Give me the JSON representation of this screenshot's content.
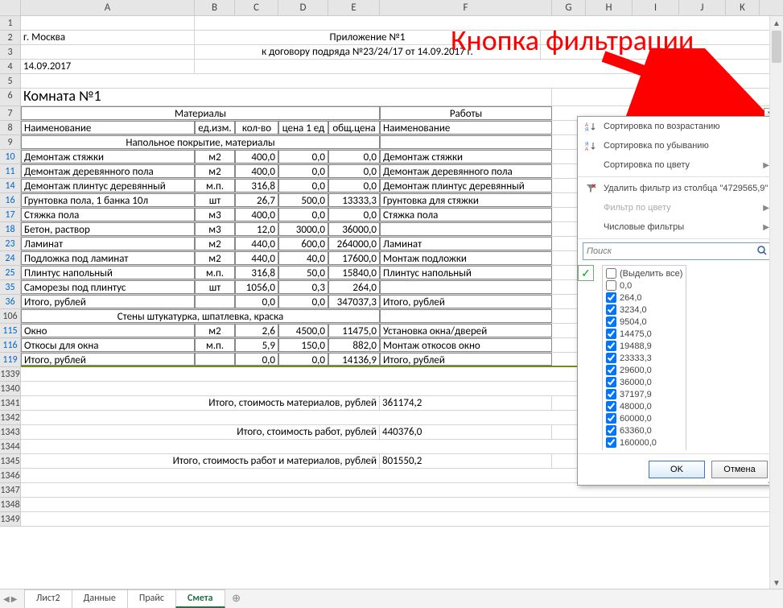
{
  "annotation": "Кнопка фильтрации",
  "columns": [
    "A",
    "B",
    "C",
    "D",
    "E",
    "F",
    "G",
    "H",
    "I",
    "J",
    "K"
  ],
  "row_numbers": [
    "1",
    "2",
    "3",
    "4",
    "5",
    "6",
    "7",
    "8",
    "9",
    "10",
    "11",
    "14",
    "16",
    "17",
    "18",
    "23",
    "24",
    "25",
    "35",
    "36",
    "106",
    "115",
    "116",
    "119",
    "1339",
    "1340",
    "1341",
    "1342",
    "1343",
    "1344",
    "1345",
    "1346",
    "1347",
    "1348",
    "1349"
  ],
  "header": {
    "city": "г. Москва",
    "date": "14.09.2017",
    "title1": "Приложение №1",
    "title2": "к договору подряда №23/24/17 от 14.09.2017 г."
  },
  "room_title": "Комната №1",
  "section_materials": "Материалы",
  "section_works": "Работы",
  "cols": {
    "name": "Наименование",
    "unit": "ед.изм.",
    "qty": "кол-во",
    "price": "цена 1 ед",
    "total": "общ.цена",
    "name2": "Наименование"
  },
  "subsection1": "Напольное покрытие, материалы",
  "subsection2": "Стены штукатурка, шпатлевка, краска",
  "rows": [
    {
      "a": "Демонтаж стяжки",
      "b": "м2",
      "c": "400,0",
      "d": "0,0",
      "e": "0,0",
      "f": "Демонтаж стяжки"
    },
    {
      "a": "Демонтаж деревянного пола",
      "b": "м2",
      "c": "400,0",
      "d": "0,0",
      "e": "0,0",
      "f": "Демонтаж деревянного пола"
    },
    {
      "a": "Демонтаж плинтус деревянный",
      "b": "м.п.",
      "c": "316,8",
      "d": "0,0",
      "e": "0,0",
      "f": "Демонтаж плинтус деревянный"
    },
    {
      "a": "Грунтовка пола, 1 банка 10л",
      "b": "шт",
      "c": "26,7",
      "d": "500,0",
      "e": "13333,3",
      "f": "Грунтовка для стяжки"
    },
    {
      "a": "Стяжка пола",
      "b": "м3",
      "c": "400,0",
      "d": "0,0",
      "e": "0,0",
      "f": "Стяжка пола"
    },
    {
      "a": "Бетон, раствор",
      "b": "м3",
      "c": "12,0",
      "d": "3000,0",
      "e": "36000,0",
      "f": ""
    },
    {
      "a": "Ламинат",
      "b": "м2",
      "c": "440,0",
      "d": "600,0",
      "e": "264000,0",
      "f": "Ламинат"
    },
    {
      "a": "Подложка под ламинат",
      "b": "м2",
      "c": "440,0",
      "d": "40,0",
      "e": "17600,0",
      "f": "Монтаж подложки"
    },
    {
      "a": "Плинтус напольный",
      "b": "м.п.",
      "c": "316,8",
      "d": "50,0",
      "e": "15840,0",
      "f": "Плинтус напольный"
    },
    {
      "a": "Саморезы под плинтус",
      "b": "шт",
      "c": "1056,0",
      "d": "0,3",
      "e": "264,0",
      "f": ""
    },
    {
      "a": "Итого, рублей",
      "b": "",
      "c": "0,0",
      "d": "0,0",
      "e": "347037,3",
      "f": "Итого, рублей"
    }
  ],
  "rows2": [
    {
      "a": "Окно",
      "b": "м2",
      "c": "2,6",
      "d": "4500,0",
      "e": "11475,0",
      "f": "Установка окна/дверей"
    },
    {
      "a": "Откосы для окна",
      "b": "м.п.",
      "c": "5,9",
      "d": "150,0",
      "e": "882,0",
      "f": "Монтаж откосов окно"
    },
    {
      "a": "Итого, рублей",
      "b": "",
      "c": "0,0",
      "d": "0,0",
      "e": "14136,9",
      "f": "Итого, рублей"
    }
  ],
  "totals": [
    {
      "label": "Итого, стоимость материалов, рублей",
      "val": "361174,2"
    },
    {
      "label": "Итого, стоимость работ, рублей",
      "val": "440376,0"
    },
    {
      "label": "Итого, стоимость работ и материалов, рублей",
      "val": "801550,2"
    }
  ],
  "filter": {
    "sort_asc": "Сортировка по возрастанию",
    "sort_desc": "Сортировка по убыванию",
    "sort_color": "Сортировка по цвету",
    "clear": "Удалить фильтр из столбца \"4729565,9\"",
    "filter_color": "Фильтр по цвету",
    "num_filters": "Числовые фильтры",
    "search_placeholder": "Поиск",
    "select_all": "(Выделить все)",
    "values": [
      "0,0",
      "264,0",
      "3234,0",
      "9504,0",
      "14475,0",
      "19488,9",
      "23333,3",
      "29600,0",
      "36000,0",
      "37197,9",
      "48000,0",
      "60000,0",
      "63360,0",
      "160000,0"
    ],
    "ok": "OK",
    "cancel": "Отмена"
  },
  "tabs": [
    "Лист2",
    "Данные",
    "Прайс",
    "Смета"
  ],
  "active_tab": "Смета"
}
